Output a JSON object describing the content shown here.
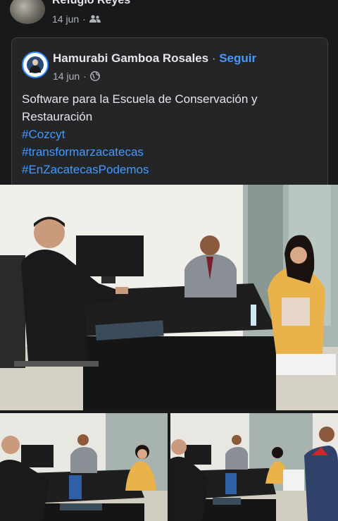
{
  "top_post": {
    "author": "Refugio Reyes",
    "date": "14 jun",
    "separator": "·",
    "audience_icon": "friends-icon"
  },
  "shared_post": {
    "author": "Hamurabi Gamboa Rosales",
    "separator": "·",
    "follow_label": "Seguir",
    "date": "14 jun",
    "audience_icon": "globe-icon",
    "text": "Software para la Escuela de Conservación y Restauración",
    "hashtags": [
      "#Cozcyt",
      "#transformarzacatecas",
      "#EnZacatecasPodemos"
    ]
  },
  "colors": {
    "background": "#18191a",
    "card": "#242526",
    "link": "#4599ff",
    "text": "#e4e6eb",
    "muted": "#b0b3b8"
  }
}
